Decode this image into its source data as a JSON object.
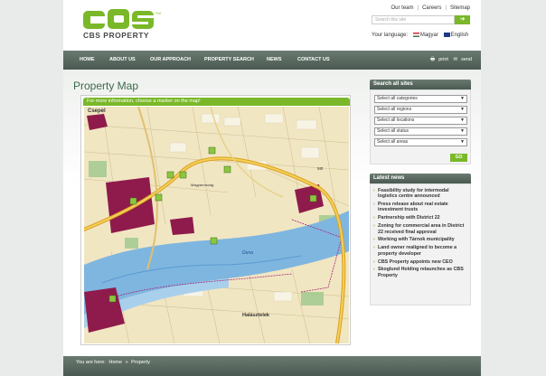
{
  "header": {
    "brand": "CBS PROPERTY",
    "top_links": [
      "Our team",
      "Careers",
      "Sitemap"
    ],
    "search_placeholder": "Search this site",
    "search_button": "➔",
    "language_label": "Your language:",
    "languages": [
      "Magyar",
      "English"
    ]
  },
  "nav": {
    "items": [
      "HOME",
      "ABOUT US",
      "OUR APPROACH",
      "PROPERTY SEARCH",
      "NEWS",
      "CONTACT US"
    ],
    "print": "print",
    "send": "send"
  },
  "main": {
    "title": "Property Map",
    "map_hint": "For more information, choose a marker on the map!",
    "map_labels": {
      "top_left": "Csepel",
      "center": "Magyarország",
      "river": "Duna",
      "town": "Halásztelek",
      "road": "M0"
    }
  },
  "sidebar": {
    "search_title": "Search all sites",
    "selects": [
      "Select all categories",
      "Select all regions",
      "Select all locations",
      "Select all status",
      "Select all areas"
    ],
    "go": "GO",
    "news_title": "Latest news",
    "news": [
      "Feasibility study for intermodal logistics centre announced",
      "Press release about real estate investment trusts",
      "Partnership with District 22",
      "Zoning for commercial area in District 22 received final approval",
      "Working with Tárnok municipality",
      "Land owner realigned to become a property developer",
      "CBS Property appoints new CEO",
      "Skoglund Holding relaunches as CBS Property"
    ]
  },
  "footer": {
    "prefix": "You are here:",
    "crumbs": [
      "Home",
      "Property"
    ],
    "sep": "»"
  },
  "colors": {
    "accent": "#7ab829",
    "nav": "#55645b",
    "title": "#3d6a4a"
  }
}
